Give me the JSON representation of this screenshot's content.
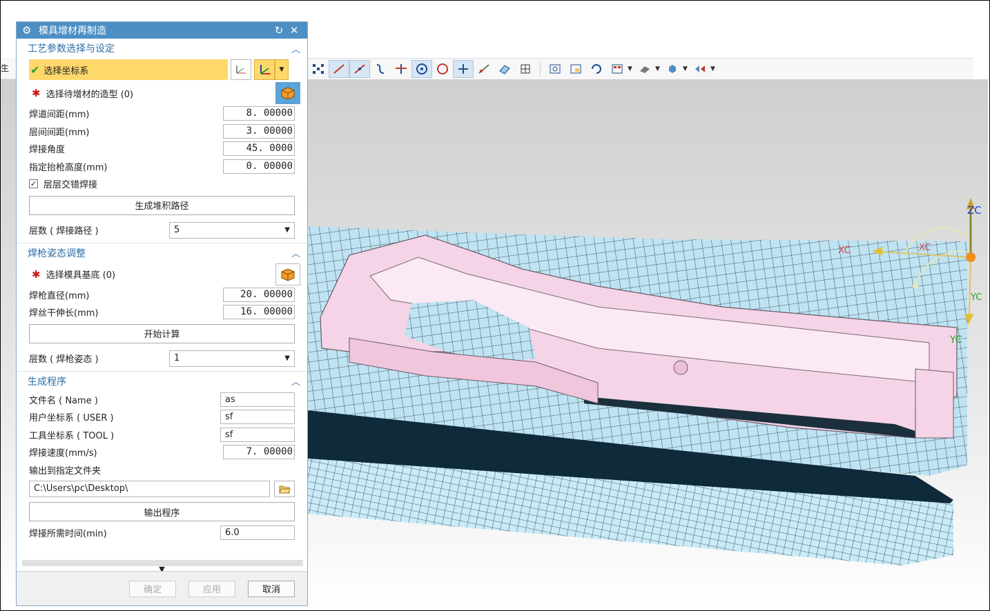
{
  "dialog": {
    "title": "模具增材再制造",
    "sections": {
      "process": {
        "title": "工艺参数选择与设定",
        "select_csys": "选择坐标系",
        "select_model": "选择待增材的造型 (0)",
        "fields": [
          {
            "label": "焊道间距(mm)",
            "value": "8. 00000"
          },
          {
            "label": "层间间距(mm)",
            "value": "3. 00000"
          },
          {
            "label": "焊接角度",
            "value": "45. 0000"
          },
          {
            "label": "指定抬枪高度(mm)",
            "value": "0. 00000"
          }
        ],
        "checkbox_label": "层层交错焊接",
        "checkbox_checked": true,
        "button": "生成堆积路径",
        "layers_label": "层数 ( 焊接路径 )",
        "layers_value": "5"
      },
      "torch": {
        "title": "焊枪姿态调整",
        "select_base": "选择模具基底 (0)",
        "fields": [
          {
            "label": "焊枪直径(mm)",
            "value": "20. 00000"
          },
          {
            "label": "焊丝干伸长(mm)",
            "value": "16. 00000"
          }
        ],
        "button": "开始计算",
        "layers_label": "层数 ( 焊枪姿态 )",
        "layers_value": "1"
      },
      "program": {
        "title": "生成程序",
        "fields": [
          {
            "label": "文件名 ( Name )",
            "value": "as"
          },
          {
            "label": "用户坐标系 ( USER )",
            "value": "sf"
          },
          {
            "label": "工具坐标系 ( TOOL )",
            "value": "sf"
          }
        ],
        "speed_label": "焊接速度(mm/s)",
        "speed_value": "7. 00000",
        "folder_label": "输出到指定文件夹",
        "folder_path": "C:\\Users\\pc\\Desktop\\",
        "output_button": "输出程序",
        "time_label": "焊接所需时间(min)",
        "time_value": "6.0"
      }
    },
    "footer": {
      "ok": "确定",
      "apply": "应用",
      "cancel": "取消"
    }
  },
  "left_toolbar_fragment": "生工",
  "axes": {
    "x": "XC",
    "y": "YC",
    "z": "ZC"
  },
  "colors": {
    "title_bar": "#4d8fc4",
    "section_title": "#2c6ea8",
    "highlight": "#ffd86b",
    "mesh": "#bfe3f2",
    "part": "#f4cfe3"
  }
}
